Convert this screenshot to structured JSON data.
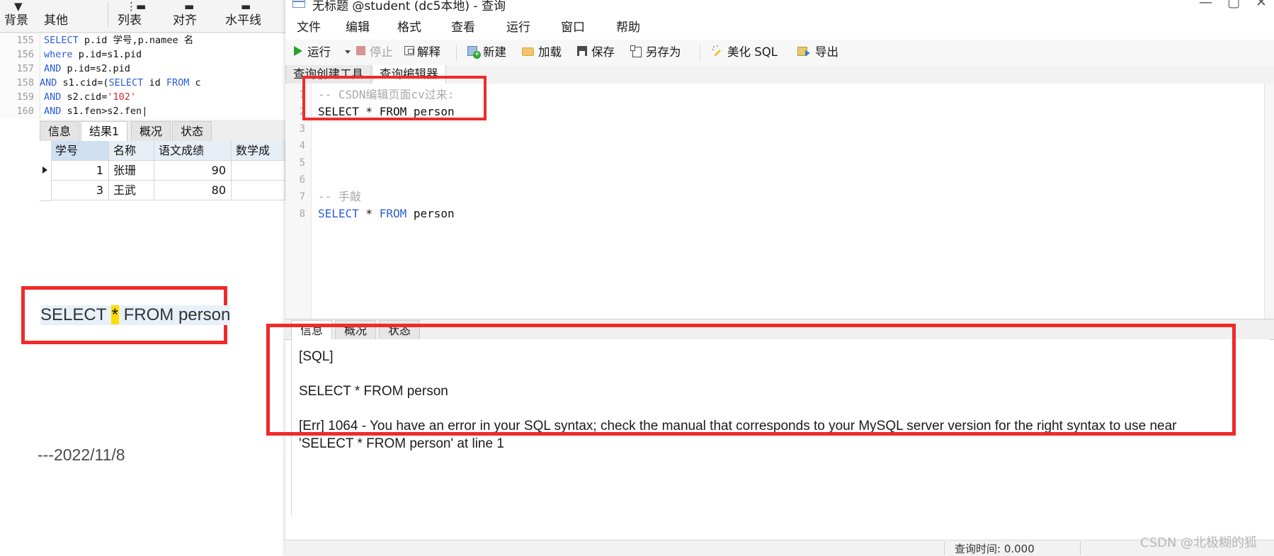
{
  "left_window": {
    "ribbon": {
      "items": [
        {
          "label": "背景",
          "glyph": "▼▮"
        },
        {
          "label": "其他",
          "glyph": "⋮≡"
        },
        {
          "label": "列表",
          "glyph": "⋮—"
        },
        {
          "label": "对齐",
          "glyph": "▬"
        },
        {
          "label": "水平线",
          "glyph": "▬"
        }
      ]
    },
    "editor": {
      "lines": [
        {
          "no": "155",
          "segments": [
            {
              "t": "SELECT",
              "c": "kw"
            },
            {
              "t": " p.id 学号,p.namee 名",
              "c": "plain"
            }
          ]
        },
        {
          "no": "156",
          "segments": [
            {
              "t": "where",
              "c": "kw"
            },
            {
              "t": " p.id=s1.pid",
              "c": "plain"
            }
          ]
        },
        {
          "no": "157",
          "segments": [
            {
              "t": "AND",
              "c": "kw"
            },
            {
              "t": " p.id=s2.pid",
              "c": "plain"
            }
          ]
        },
        {
          "no": "158",
          "segments": [
            {
              "t": "AND",
              "c": "kw"
            },
            {
              "t": " s1.cid=(",
              "c": "plain"
            },
            {
              "t": "SELECT",
              "c": "kw"
            },
            {
              "t": " id ",
              "c": "plain"
            },
            {
              "t": "FROM",
              "c": "kw"
            },
            {
              "t": " c",
              "c": "plain"
            }
          ]
        },
        {
          "no": "159",
          "segments": [
            {
              "t": "AND",
              "c": "kw"
            },
            {
              "t": " s2.cid=",
              "c": "plain"
            },
            {
              "t": "'102'",
              "c": "str"
            }
          ]
        },
        {
          "no": "160",
          "segments": [
            {
              "t": "AND",
              "c": "kw"
            },
            {
              "t": " s1.fen>s2.fen",
              "c": "plain"
            }
          ]
        }
      ]
    },
    "result_tabs": [
      {
        "label": "信息",
        "active": false
      },
      {
        "label": "结果1",
        "active": true
      },
      {
        "label": "概况",
        "active": false
      },
      {
        "label": "状态",
        "active": false
      }
    ],
    "grid": {
      "headers": [
        "学号",
        "名称",
        "语文成绩",
        "数学成"
      ],
      "rows": [
        {
          "id": "1",
          "name": "张珊",
          "chinese": "90",
          "math": ""
        },
        {
          "id": "3",
          "name": "王武",
          "chinese": "80",
          "math": ""
        }
      ]
    },
    "callout_sql": {
      "before": "SELECT ",
      "star": "*",
      "after": " FROM person"
    },
    "date_note": "---2022/11/8"
  },
  "navicat": {
    "titlebar": {
      "title": "无标题 @student (dc5本地) - 查询",
      "minimize": "—",
      "maximize": "▢",
      "close": "✕"
    },
    "menubar": {
      "items": [
        "文件",
        "编辑",
        "格式",
        "查看",
        "运行",
        "窗口",
        "帮助"
      ]
    },
    "toolbar": {
      "run": "运行",
      "stop": "停止",
      "explain": "解释",
      "new": "新建",
      "load": "加载",
      "save": "保存",
      "save_as": "另存为",
      "beautify": "美化 SQL",
      "export": "导出"
    },
    "editor_tabs": [
      {
        "label": "查询创建工具",
        "active": false
      },
      {
        "label": "查询编辑器",
        "active": true
      }
    ],
    "sql_editor": {
      "lines": [
        {
          "no": "1",
          "segments": [
            {
              "t": "-- CSDN编辑页面cv过来:",
              "c": "sql-comment"
            }
          ]
        },
        {
          "no": "2",
          "segments": [
            {
              "t": "SELECT * FROM person",
              "c": "sql-txt"
            }
          ]
        },
        {
          "no": "3",
          "segments": []
        },
        {
          "no": "4",
          "segments": []
        },
        {
          "no": "5",
          "segments": []
        },
        {
          "no": "6",
          "segments": []
        },
        {
          "no": "7",
          "segments": [
            {
              "t": "-- 手敲",
              "c": "sql-comment"
            }
          ]
        },
        {
          "no": "8",
          "segments": [
            {
              "t": "SELECT",
              "c": "sql-kw"
            },
            {
              "t": " * ",
              "c": "sql-txt"
            },
            {
              "t": "FROM",
              "c": "sql-kw"
            },
            {
              "t": " person",
              "c": "sql-txt"
            }
          ]
        }
      ]
    },
    "info_tabs": [
      {
        "label": "信息",
        "active": true
      },
      {
        "label": "概况",
        "active": false
      },
      {
        "label": "状态",
        "active": false
      }
    ],
    "info_body": {
      "lines": [
        "[SQL]",
        "SELECT * FROM person",
        "[Err] 1064 - You have an error in your SQL syntax; check the manual that corresponds to your MySQL server version for the right syntax to use near",
        "'SELECT * FROM person' at line 1"
      ]
    },
    "statusbar": {
      "query_time_label": "查询时间: 0.000"
    }
  },
  "watermark": "CSDN @北极糊的狐",
  "colors": {
    "callout_red": "#ef2a2a",
    "highlight_yellow": "#ffdd00",
    "selection_blue": "#e8f1fa",
    "sql_keyword": "#2a5cdb",
    "sql_string": "#d02a2a",
    "run_green": "#23a523"
  }
}
